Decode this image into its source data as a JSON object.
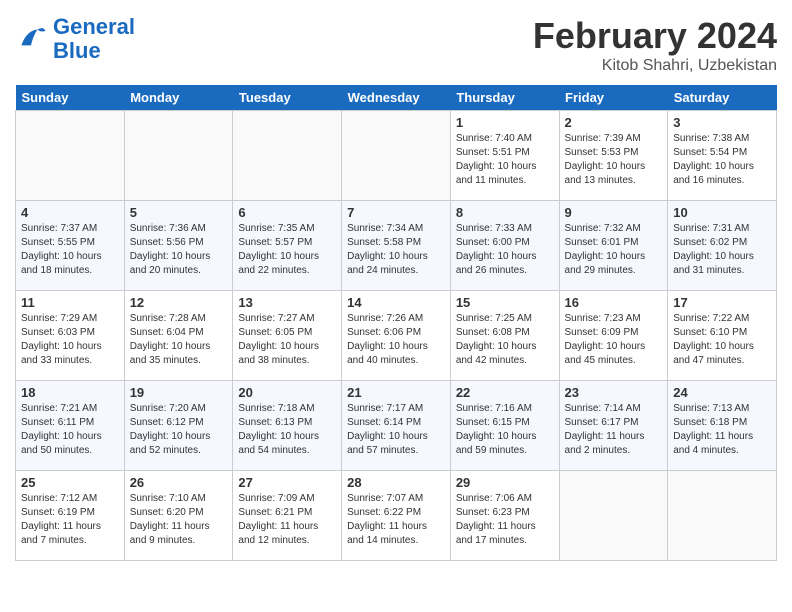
{
  "app": {
    "logo_general": "General",
    "logo_blue": "Blue",
    "month_title": "February 2024",
    "location": "Kitob Shahri, Uzbekistan"
  },
  "calendar": {
    "headers": [
      "Sunday",
      "Monday",
      "Tuesday",
      "Wednesday",
      "Thursday",
      "Friday",
      "Saturday"
    ],
    "weeks": [
      [
        {
          "day": "",
          "info": ""
        },
        {
          "day": "",
          "info": ""
        },
        {
          "day": "",
          "info": ""
        },
        {
          "day": "",
          "info": ""
        },
        {
          "day": "1",
          "info": "Sunrise: 7:40 AM\nSunset: 5:51 PM\nDaylight: 10 hours\nand 11 minutes."
        },
        {
          "day": "2",
          "info": "Sunrise: 7:39 AM\nSunset: 5:53 PM\nDaylight: 10 hours\nand 13 minutes."
        },
        {
          "day": "3",
          "info": "Sunrise: 7:38 AM\nSunset: 5:54 PM\nDaylight: 10 hours\nand 16 minutes."
        }
      ],
      [
        {
          "day": "4",
          "info": "Sunrise: 7:37 AM\nSunset: 5:55 PM\nDaylight: 10 hours\nand 18 minutes."
        },
        {
          "day": "5",
          "info": "Sunrise: 7:36 AM\nSunset: 5:56 PM\nDaylight: 10 hours\nand 20 minutes."
        },
        {
          "day": "6",
          "info": "Sunrise: 7:35 AM\nSunset: 5:57 PM\nDaylight: 10 hours\nand 22 minutes."
        },
        {
          "day": "7",
          "info": "Sunrise: 7:34 AM\nSunset: 5:58 PM\nDaylight: 10 hours\nand 24 minutes."
        },
        {
          "day": "8",
          "info": "Sunrise: 7:33 AM\nSunset: 6:00 PM\nDaylight: 10 hours\nand 26 minutes."
        },
        {
          "day": "9",
          "info": "Sunrise: 7:32 AM\nSunset: 6:01 PM\nDaylight: 10 hours\nand 29 minutes."
        },
        {
          "day": "10",
          "info": "Sunrise: 7:31 AM\nSunset: 6:02 PM\nDaylight: 10 hours\nand 31 minutes."
        }
      ],
      [
        {
          "day": "11",
          "info": "Sunrise: 7:29 AM\nSunset: 6:03 PM\nDaylight: 10 hours\nand 33 minutes."
        },
        {
          "day": "12",
          "info": "Sunrise: 7:28 AM\nSunset: 6:04 PM\nDaylight: 10 hours\nand 35 minutes."
        },
        {
          "day": "13",
          "info": "Sunrise: 7:27 AM\nSunset: 6:05 PM\nDaylight: 10 hours\nand 38 minutes."
        },
        {
          "day": "14",
          "info": "Sunrise: 7:26 AM\nSunset: 6:06 PM\nDaylight: 10 hours\nand 40 minutes."
        },
        {
          "day": "15",
          "info": "Sunrise: 7:25 AM\nSunset: 6:08 PM\nDaylight: 10 hours\nand 42 minutes."
        },
        {
          "day": "16",
          "info": "Sunrise: 7:23 AM\nSunset: 6:09 PM\nDaylight: 10 hours\nand 45 minutes."
        },
        {
          "day": "17",
          "info": "Sunrise: 7:22 AM\nSunset: 6:10 PM\nDaylight: 10 hours\nand 47 minutes."
        }
      ],
      [
        {
          "day": "18",
          "info": "Sunrise: 7:21 AM\nSunset: 6:11 PM\nDaylight: 10 hours\nand 50 minutes."
        },
        {
          "day": "19",
          "info": "Sunrise: 7:20 AM\nSunset: 6:12 PM\nDaylight: 10 hours\nand 52 minutes."
        },
        {
          "day": "20",
          "info": "Sunrise: 7:18 AM\nSunset: 6:13 PM\nDaylight: 10 hours\nand 54 minutes."
        },
        {
          "day": "21",
          "info": "Sunrise: 7:17 AM\nSunset: 6:14 PM\nDaylight: 10 hours\nand 57 minutes."
        },
        {
          "day": "22",
          "info": "Sunrise: 7:16 AM\nSunset: 6:15 PM\nDaylight: 10 hours\nand 59 minutes."
        },
        {
          "day": "23",
          "info": "Sunrise: 7:14 AM\nSunset: 6:17 PM\nDaylight: 11 hours\nand 2 minutes."
        },
        {
          "day": "24",
          "info": "Sunrise: 7:13 AM\nSunset: 6:18 PM\nDaylight: 11 hours\nand 4 minutes."
        }
      ],
      [
        {
          "day": "25",
          "info": "Sunrise: 7:12 AM\nSunset: 6:19 PM\nDaylight: 11 hours\nand 7 minutes."
        },
        {
          "day": "26",
          "info": "Sunrise: 7:10 AM\nSunset: 6:20 PM\nDaylight: 11 hours\nand 9 minutes."
        },
        {
          "day": "27",
          "info": "Sunrise: 7:09 AM\nSunset: 6:21 PM\nDaylight: 11 hours\nand 12 minutes."
        },
        {
          "day": "28",
          "info": "Sunrise: 7:07 AM\nSunset: 6:22 PM\nDaylight: 11 hours\nand 14 minutes."
        },
        {
          "day": "29",
          "info": "Sunrise: 7:06 AM\nSunset: 6:23 PM\nDaylight: 11 hours\nand 17 minutes."
        },
        {
          "day": "",
          "info": ""
        },
        {
          "day": "",
          "info": ""
        }
      ]
    ]
  }
}
